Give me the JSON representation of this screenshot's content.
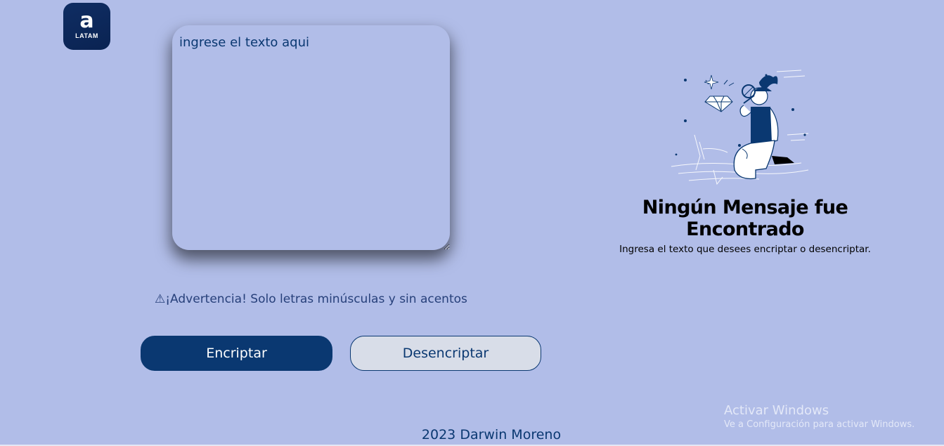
{
  "logo": {
    "letter": "a",
    "subtitle": "LATAM"
  },
  "input": {
    "placeholder": "ingrese el texto aqui",
    "value": ""
  },
  "warning": "⚠¡Advertencia! Solo letras minúsculas y sin acentos",
  "buttons": {
    "encrypt_label": "Encriptar",
    "decrypt_label": "Desencriptar"
  },
  "output": {
    "illustration_icon": "person-with-magnifying-glass-and-diamond",
    "title_line1": "Ningún Mensaje fue",
    "title_line2": "Encontrado",
    "subtitle": "Ingresa el texto que desees encriptar o desencriptar."
  },
  "footer": {
    "text": "2023 Darwin Moreno"
  },
  "watermark": {
    "title": "Activar Windows",
    "subtitle": "Ve a Configuración para activar Windows."
  },
  "colors": {
    "background": "#b1bde8",
    "primary": "#0a3871",
    "secondary_button": "#d8dde8",
    "logo_background": "#0f2d63"
  }
}
